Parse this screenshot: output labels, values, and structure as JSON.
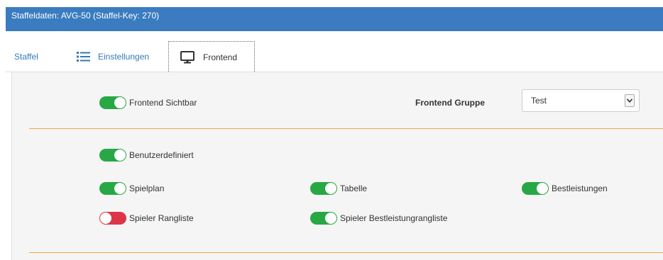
{
  "header": {
    "title": "Staffeldaten: AVG-50 (Staffel-Key: 270)"
  },
  "tabs": [
    {
      "label": "Staffel",
      "icon": "none"
    },
    {
      "label": "Einstellungen",
      "icon": "list-icon"
    },
    {
      "label": "Frontend",
      "icon": "monitor-icon",
      "active": true
    }
  ],
  "frontend": {
    "visible_label": "Frontend Sichtbar",
    "visible_state": "on",
    "group_label": "Frontend Gruppe",
    "group_value": "Test"
  },
  "options": {
    "custom_label": "Benutzerdefiniert",
    "custom_state": "on",
    "spielplan_label": "Spielplan",
    "spielplan_state": "on",
    "tabelle_label": "Tabelle",
    "tabelle_state": "on",
    "bestleistungen_label": "Bestleistungen",
    "bestleistungen_state": "on",
    "rangliste_label": "Spieler Rangliste",
    "rangliste_state": "off",
    "bestleistungrangliste_label": "Spieler Bestleistungrangliste",
    "bestleistungrangliste_state": "on"
  },
  "colors": {
    "header_bg": "#3a7cbf",
    "toggle_on": "#28a745",
    "toggle_off": "#dc3545",
    "divider": "#f0a64a",
    "link": "#337ab7"
  }
}
